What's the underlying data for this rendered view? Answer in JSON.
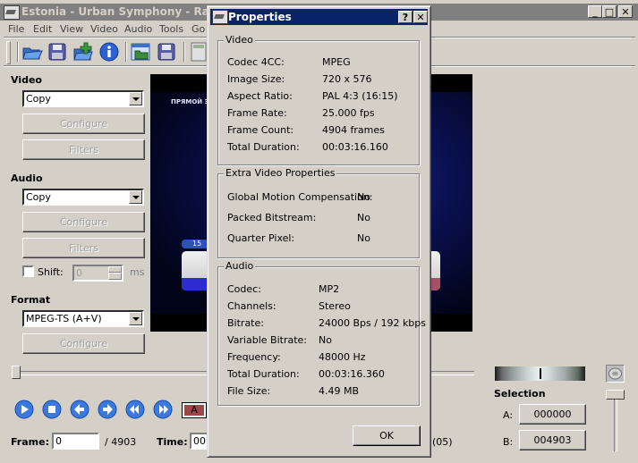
{
  "main_window": {
    "title": "Estonia - Urban Symphony - Randajad",
    "controls": {
      "minimize": "_",
      "maximize": "□",
      "close": "✕"
    }
  },
  "menu": [
    "File",
    "Edit",
    "View",
    "Video",
    "Audio",
    "Tools",
    "Go"
  ],
  "toolbar": {
    "icons": [
      "open-icon",
      "save-icon",
      "append-icon",
      "info-icon",
      "open-folder-icon",
      "save-as-icon",
      "calculator-icon"
    ]
  },
  "left_panel": {
    "video": {
      "label": "Video",
      "codec_selected": "Copy",
      "configure_label": "Configure",
      "filters_label": "Filters"
    },
    "audio": {
      "label": "Audio",
      "codec_selected": "Copy",
      "configure_label": "Configure",
      "filters_label": "Filters",
      "shift_label": "Shift:",
      "shift_checked": false,
      "shift_value": "0",
      "shift_unit": "ms"
    },
    "format": {
      "label": "Format",
      "selected": "MPEG-TS (A+V)",
      "configure_label": "Configure"
    }
  },
  "preview": {
    "overlay_text": "ПРЯМОЙ Э",
    "badge_text": "15"
  },
  "navigation": {
    "seek_position": 0,
    "buttons": [
      "play-icon",
      "stop-icon",
      "prev-frame-icon",
      "next-frame-icon",
      "rewind-icon",
      "fast-forward-icon"
    ],
    "marker_label": "A",
    "frame_label": "Frame:",
    "frame_value": "0",
    "frame_total": "/ 4903",
    "time_label": "Time:",
    "time_value": "00",
    "time_suffix": "(05)"
  },
  "selection": {
    "label": "Selection",
    "a_label": "A:",
    "a_value": "000000",
    "b_label": "B:",
    "b_value": "004903"
  },
  "dialog": {
    "title": "Properties",
    "help_label": "?",
    "close_label": "✕",
    "video": {
      "title": "Video",
      "rows": [
        {
          "label": "Codec 4CC:",
          "value": "MPEG"
        },
        {
          "label": "Image Size:",
          "value": "720 x 576"
        },
        {
          "label": "Aspect Ratio:",
          "value": "PAL 4:3 (16:15)"
        },
        {
          "label": "Frame Rate:",
          "value": "25.000 fps"
        },
        {
          "label": "Frame Count:",
          "value": "4904 frames"
        },
        {
          "label": "Total Duration:",
          "value": "00:03:16.160"
        }
      ]
    },
    "extra": {
      "title": "Extra Video Properties",
      "rows": [
        {
          "label": "Global Motion Compensation:",
          "value": "No"
        },
        {
          "label": "Packed Bitstream:",
          "value": "No"
        },
        {
          "label": "Quarter Pixel:",
          "value": "No"
        }
      ]
    },
    "audio": {
      "title": "Audio",
      "rows": [
        {
          "label": "Codec:",
          "value": "MP2"
        },
        {
          "label": "Channels:",
          "value": "Stereo"
        },
        {
          "label": "Bitrate:",
          "value": "24000 Bps / 192 kbps"
        },
        {
          "label": "Variable Bitrate:",
          "value": "No"
        },
        {
          "label": "Frequency:",
          "value": "48000 Hz"
        },
        {
          "label": "Total Duration:",
          "value": "00:03:16.360"
        },
        {
          "label": "File Size:",
          "value": "4.49 MB"
        }
      ]
    },
    "ok_label": "OK"
  },
  "colors": {
    "dialog_titlebar": "#0a246a",
    "inactive_titlebar": "#808080",
    "face": "#d4d0c8"
  }
}
